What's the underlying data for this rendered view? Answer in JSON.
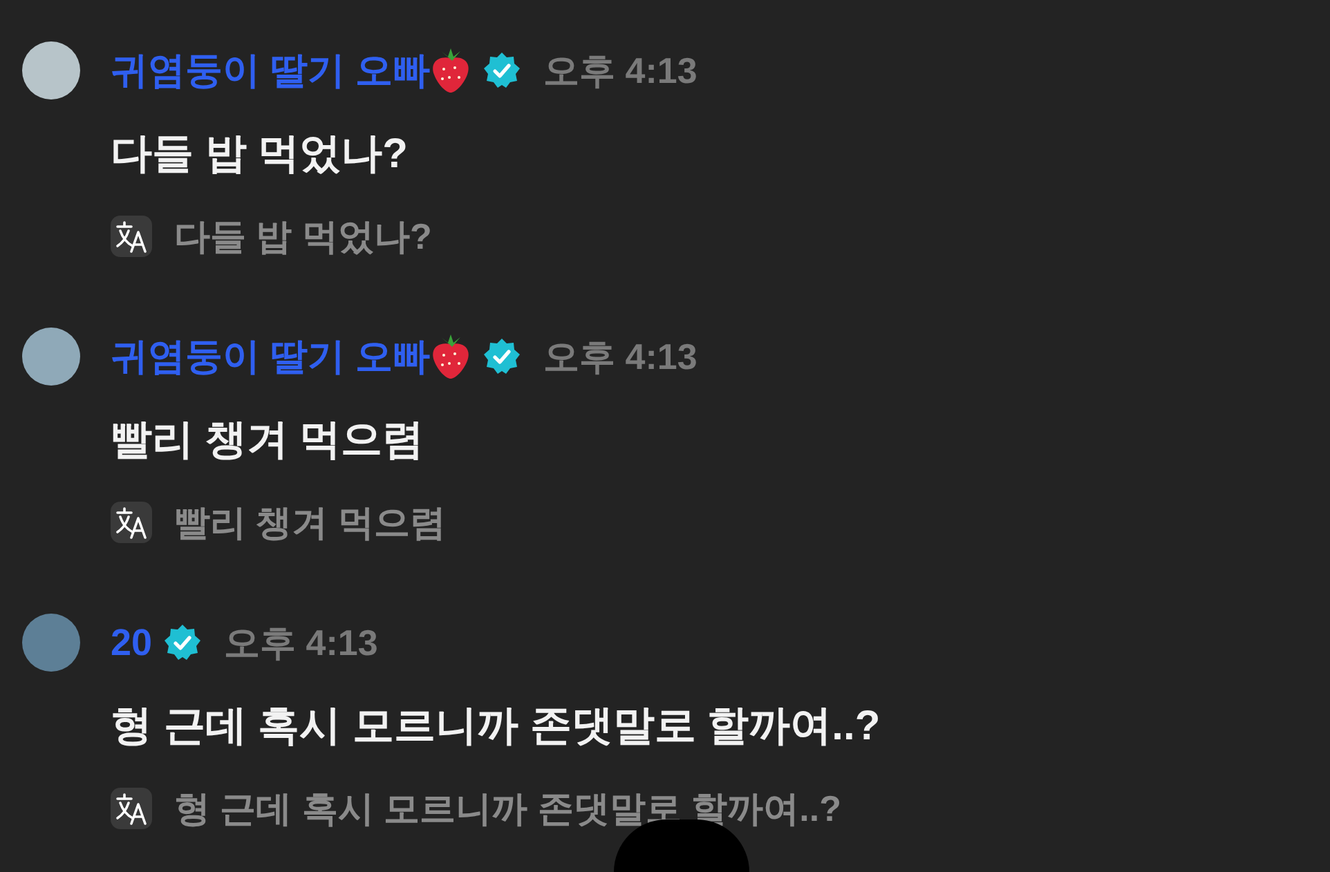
{
  "messages": [
    {
      "author": "귀염둥이 딸기 오빠",
      "strawberry": true,
      "verified": true,
      "time": "오후 4:13",
      "text": "다들 밥 먹었나?",
      "translation": "다들 밥 먹었나?"
    },
    {
      "author": "귀염둥이 딸기 오빠",
      "strawberry": true,
      "verified": true,
      "time": "오후 4:13",
      "text": "빨리 챙겨 먹으렴",
      "translation": "빨리 챙겨 먹으렴"
    },
    {
      "author": "20",
      "strawberry": false,
      "verified": true,
      "time": "오후 4:13",
      "text": "형 근데 혹시 모르니까 존댓말로 할까여..?",
      "translation": "형 근데 혹시 모르니까 존댓말로 할까여..?"
    }
  ]
}
